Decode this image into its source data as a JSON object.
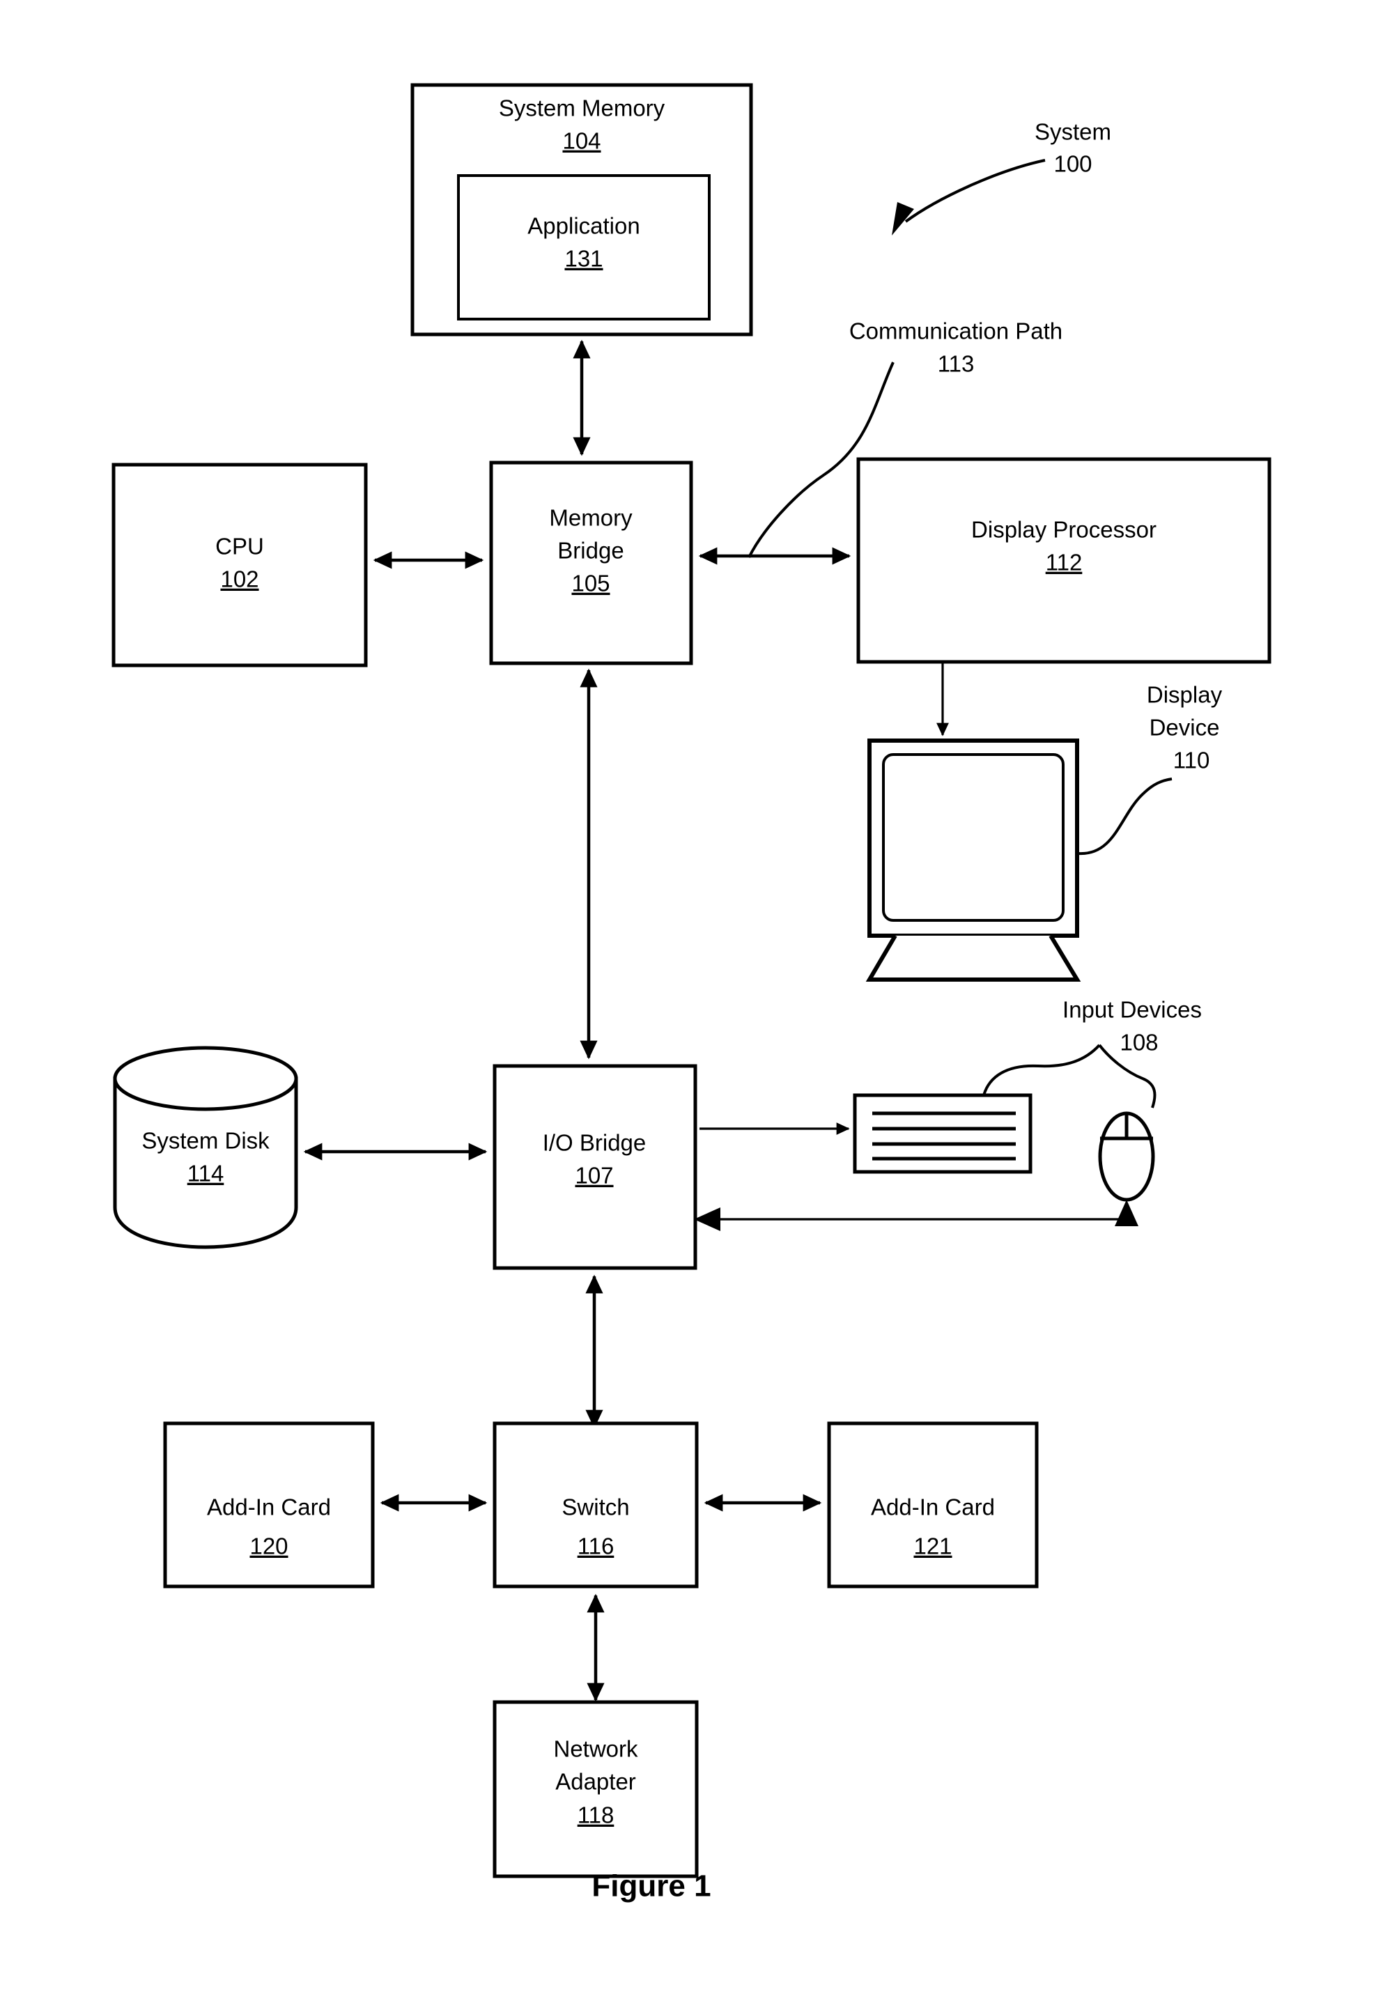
{
  "figure": {
    "caption": "Figure 1"
  },
  "callouts": {
    "system": {
      "name": "System",
      "number": "100"
    },
    "communication_path": {
      "name": "Communication Path",
      "number": "113"
    },
    "display_device": {
      "name_line1": "Display",
      "name_line2": "Device",
      "number": "110"
    },
    "input_devices": {
      "name": "Input Devices",
      "number": "108"
    }
  },
  "blocks": {
    "system_memory": {
      "label": "System Memory",
      "number": "104"
    },
    "application": {
      "label": "Application",
      "number": "131"
    },
    "cpu": {
      "label": "CPU",
      "number": "102"
    },
    "memory_bridge": {
      "label_line1": "Memory",
      "label_line2": "Bridge",
      "number": "105"
    },
    "display_processor": {
      "label": "Display Processor",
      "number": "112"
    },
    "system_disk": {
      "label": "System Disk",
      "number": "114"
    },
    "io_bridge": {
      "label": "I/O Bridge",
      "number": "107"
    },
    "switch": {
      "label": "Switch",
      "number": "116"
    },
    "add_in_card_left": {
      "label": "Add-In Card",
      "number": "120"
    },
    "add_in_card_right": {
      "label": "Add-In Card",
      "number": "121"
    },
    "network_adapter": {
      "label_line1": "Network",
      "label_line2": "Adapter",
      "number": "118"
    }
  },
  "icons": {
    "display_device": "monitor-icon",
    "keyboard": "keyboard-icon",
    "mouse": "mouse-icon",
    "system_disk": "cylinder-disk-icon"
  },
  "colors": {
    "stroke": "#000000",
    "fill": "#ffffff",
    "background": "#ffffff"
  }
}
